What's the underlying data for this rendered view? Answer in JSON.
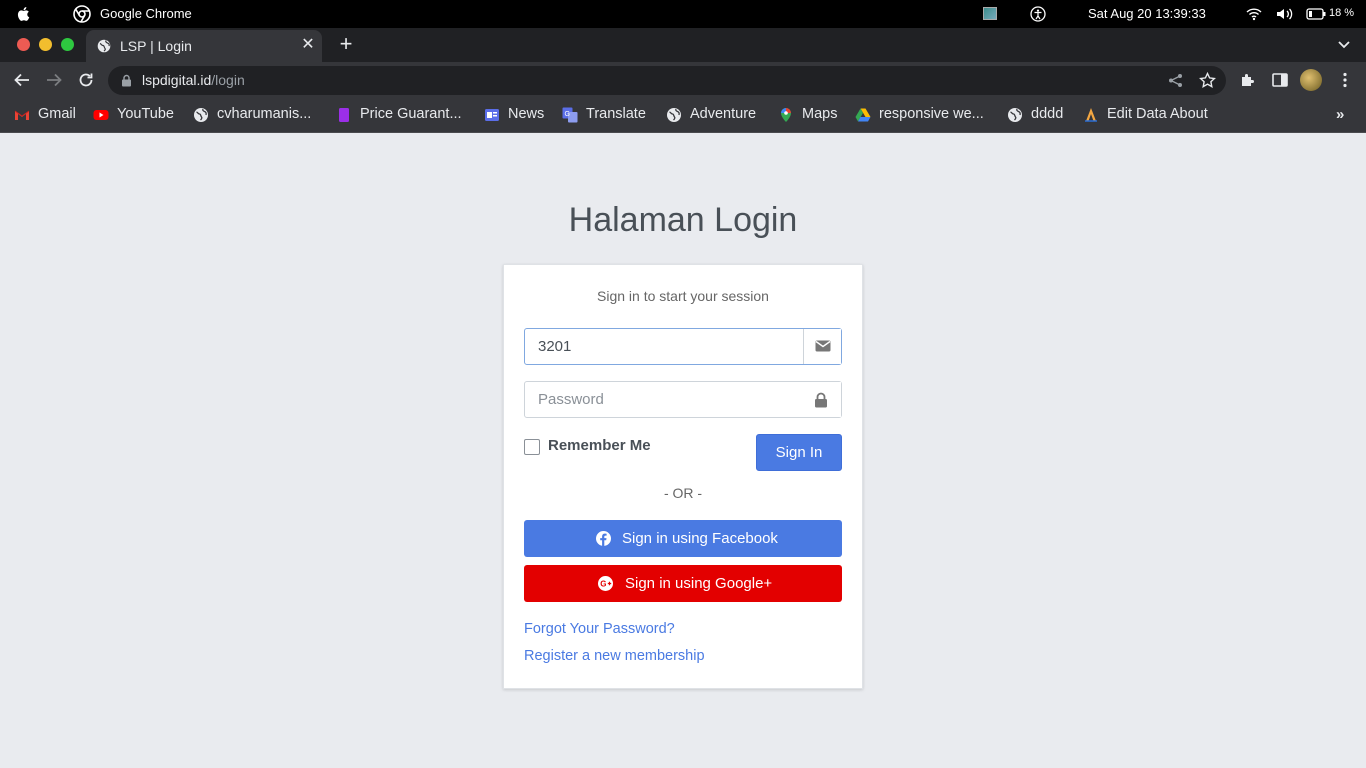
{
  "menubar": {
    "app_name": "Google Chrome",
    "clock": "Sat Aug 20  13:39:33",
    "battery": "18 %"
  },
  "tab": {
    "title": "LSP | Login"
  },
  "omnibox": {
    "url_host": "lspdigital.id",
    "url_path": "/login"
  },
  "bookmarks": [
    {
      "label": "Gmail",
      "icon": "gmail-icon"
    },
    {
      "label": "YouTube",
      "icon": "youtube-icon"
    },
    {
      "label": "cvharumanis...",
      "icon": "globe-icon"
    },
    {
      "label": "Price Guarant...",
      "icon": "bookmark-purple-icon"
    },
    {
      "label": "News",
      "icon": "google-news-icon"
    },
    {
      "label": "Translate",
      "icon": "google-translate-icon"
    },
    {
      "label": "Adventure",
      "icon": "globe-icon"
    },
    {
      "label": "Maps",
      "icon": "google-maps-icon"
    },
    {
      "label": "responsive we...",
      "icon": "google-drive-icon"
    },
    {
      "label": "dddd",
      "icon": "globe-icon"
    },
    {
      "label": "Edit Data About",
      "icon": "app-icon"
    }
  ],
  "page": {
    "heading": "Halaman Login",
    "message": "Sign in to start your session",
    "email_value": "3201",
    "password_placeholder": "Password",
    "remember_label": "Remember Me",
    "signin_label": "Sign In",
    "or_text": "- OR -",
    "facebook_label": "Sign in using Facebook",
    "google_label": "Sign in using Google+",
    "forgot_link": "Forgot Your Password?",
    "register_link": "Register a new membership"
  },
  "colors": {
    "primary": "#4a7ae2",
    "danger": "#e30000",
    "page_bg": "#e9ebef"
  }
}
